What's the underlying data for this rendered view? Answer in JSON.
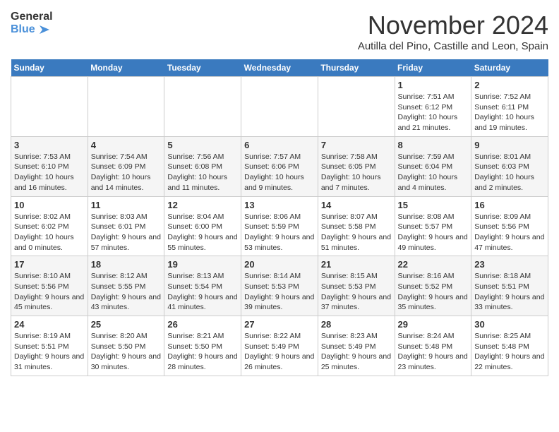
{
  "logo": {
    "line1": "General",
    "line2": "Blue"
  },
  "title": "November 2024",
  "subtitle": "Autilla del Pino, Castille and Leon, Spain",
  "weekdays": [
    "Sunday",
    "Monday",
    "Tuesday",
    "Wednesday",
    "Thursday",
    "Friday",
    "Saturday"
  ],
  "weeks": [
    [
      {
        "day": "",
        "info": ""
      },
      {
        "day": "",
        "info": ""
      },
      {
        "day": "",
        "info": ""
      },
      {
        "day": "",
        "info": ""
      },
      {
        "day": "",
        "info": ""
      },
      {
        "day": "1",
        "info": "Sunrise: 7:51 AM\nSunset: 6:12 PM\nDaylight: 10 hours and 21 minutes."
      },
      {
        "day": "2",
        "info": "Sunrise: 7:52 AM\nSunset: 6:11 PM\nDaylight: 10 hours and 19 minutes."
      }
    ],
    [
      {
        "day": "3",
        "info": "Sunrise: 7:53 AM\nSunset: 6:10 PM\nDaylight: 10 hours and 16 minutes."
      },
      {
        "day": "4",
        "info": "Sunrise: 7:54 AM\nSunset: 6:09 PM\nDaylight: 10 hours and 14 minutes."
      },
      {
        "day": "5",
        "info": "Sunrise: 7:56 AM\nSunset: 6:08 PM\nDaylight: 10 hours and 11 minutes."
      },
      {
        "day": "6",
        "info": "Sunrise: 7:57 AM\nSunset: 6:06 PM\nDaylight: 10 hours and 9 minutes."
      },
      {
        "day": "7",
        "info": "Sunrise: 7:58 AM\nSunset: 6:05 PM\nDaylight: 10 hours and 7 minutes."
      },
      {
        "day": "8",
        "info": "Sunrise: 7:59 AM\nSunset: 6:04 PM\nDaylight: 10 hours and 4 minutes."
      },
      {
        "day": "9",
        "info": "Sunrise: 8:01 AM\nSunset: 6:03 PM\nDaylight: 10 hours and 2 minutes."
      }
    ],
    [
      {
        "day": "10",
        "info": "Sunrise: 8:02 AM\nSunset: 6:02 PM\nDaylight: 10 hours and 0 minutes."
      },
      {
        "day": "11",
        "info": "Sunrise: 8:03 AM\nSunset: 6:01 PM\nDaylight: 9 hours and 57 minutes."
      },
      {
        "day": "12",
        "info": "Sunrise: 8:04 AM\nSunset: 6:00 PM\nDaylight: 9 hours and 55 minutes."
      },
      {
        "day": "13",
        "info": "Sunrise: 8:06 AM\nSunset: 5:59 PM\nDaylight: 9 hours and 53 minutes."
      },
      {
        "day": "14",
        "info": "Sunrise: 8:07 AM\nSunset: 5:58 PM\nDaylight: 9 hours and 51 minutes."
      },
      {
        "day": "15",
        "info": "Sunrise: 8:08 AM\nSunset: 5:57 PM\nDaylight: 9 hours and 49 minutes."
      },
      {
        "day": "16",
        "info": "Sunrise: 8:09 AM\nSunset: 5:56 PM\nDaylight: 9 hours and 47 minutes."
      }
    ],
    [
      {
        "day": "17",
        "info": "Sunrise: 8:10 AM\nSunset: 5:56 PM\nDaylight: 9 hours and 45 minutes."
      },
      {
        "day": "18",
        "info": "Sunrise: 8:12 AM\nSunset: 5:55 PM\nDaylight: 9 hours and 43 minutes."
      },
      {
        "day": "19",
        "info": "Sunrise: 8:13 AM\nSunset: 5:54 PM\nDaylight: 9 hours and 41 minutes."
      },
      {
        "day": "20",
        "info": "Sunrise: 8:14 AM\nSunset: 5:53 PM\nDaylight: 9 hours and 39 minutes."
      },
      {
        "day": "21",
        "info": "Sunrise: 8:15 AM\nSunset: 5:53 PM\nDaylight: 9 hours and 37 minutes."
      },
      {
        "day": "22",
        "info": "Sunrise: 8:16 AM\nSunset: 5:52 PM\nDaylight: 9 hours and 35 minutes."
      },
      {
        "day": "23",
        "info": "Sunrise: 8:18 AM\nSunset: 5:51 PM\nDaylight: 9 hours and 33 minutes."
      }
    ],
    [
      {
        "day": "24",
        "info": "Sunrise: 8:19 AM\nSunset: 5:51 PM\nDaylight: 9 hours and 31 minutes."
      },
      {
        "day": "25",
        "info": "Sunrise: 8:20 AM\nSunset: 5:50 PM\nDaylight: 9 hours and 30 minutes."
      },
      {
        "day": "26",
        "info": "Sunrise: 8:21 AM\nSunset: 5:50 PM\nDaylight: 9 hours and 28 minutes."
      },
      {
        "day": "27",
        "info": "Sunrise: 8:22 AM\nSunset: 5:49 PM\nDaylight: 9 hours and 26 minutes."
      },
      {
        "day": "28",
        "info": "Sunrise: 8:23 AM\nSunset: 5:49 PM\nDaylight: 9 hours and 25 minutes."
      },
      {
        "day": "29",
        "info": "Sunrise: 8:24 AM\nSunset: 5:48 PM\nDaylight: 9 hours and 23 minutes."
      },
      {
        "day": "30",
        "info": "Sunrise: 8:25 AM\nSunset: 5:48 PM\nDaylight: 9 hours and 22 minutes."
      }
    ]
  ]
}
